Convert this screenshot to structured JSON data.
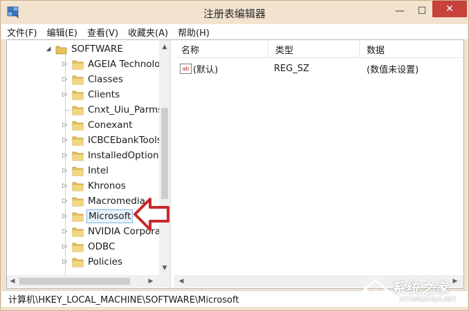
{
  "window": {
    "title": "注册表编辑器",
    "minimize_glyph": "—",
    "maximize_glyph": "☐",
    "close_glyph": "✕"
  },
  "menubar": {
    "items": [
      {
        "label": "文件(F)"
      },
      {
        "label": "编辑(E)"
      },
      {
        "label": "查看(V)"
      },
      {
        "label": "收藏夹(A)"
      },
      {
        "label": "帮助(H)"
      }
    ]
  },
  "tree": {
    "root": {
      "label": "SOFTWARE",
      "expander": "◢"
    },
    "children": [
      {
        "label": "AGEIA Technologies",
        "expander": "▷"
      },
      {
        "label": "Classes",
        "expander": "▷"
      },
      {
        "label": "Clients",
        "expander": "▷"
      },
      {
        "label": "Cnxt_Uiu_Parms",
        "expander": ""
      },
      {
        "label": "Conexant",
        "expander": "▷"
      },
      {
        "label": "ICBCEbankTools",
        "expander": "▷"
      },
      {
        "label": "InstalledOptions",
        "expander": "▷"
      },
      {
        "label": "Intel",
        "expander": "▷"
      },
      {
        "label": "Khronos",
        "expander": "▷"
      },
      {
        "label": "Macromedia",
        "expander": "▷"
      },
      {
        "label": "Microsoft",
        "expander": "▷",
        "selected": true
      },
      {
        "label": "NVIDIA Corporation",
        "expander": "▷"
      },
      {
        "label": "ODBC",
        "expander": "▷"
      },
      {
        "label": "Policies",
        "expander": "▷"
      }
    ]
  },
  "list": {
    "columns": [
      {
        "label": "名称"
      },
      {
        "label": "类型"
      },
      {
        "label": "数据"
      }
    ],
    "rows": [
      {
        "icon_text": "ab",
        "name": "(默认)",
        "type": "REG_SZ",
        "data": "(数值未设置)"
      }
    ]
  },
  "statusbar": {
    "path": "计算机\\HKEY_LOCAL_MACHINE\\SOFTWARE\\Microsoft"
  },
  "watermark": {
    "text": "系统之家",
    "subtext": "XITONGZHIJIA.NET"
  },
  "colors": {
    "chrome": "#f2e3cf",
    "close_button": "#c7423a",
    "folder": "#e8c25a",
    "pointer_arrow": "#c8282a",
    "selection_border": "#7fb3e0"
  }
}
